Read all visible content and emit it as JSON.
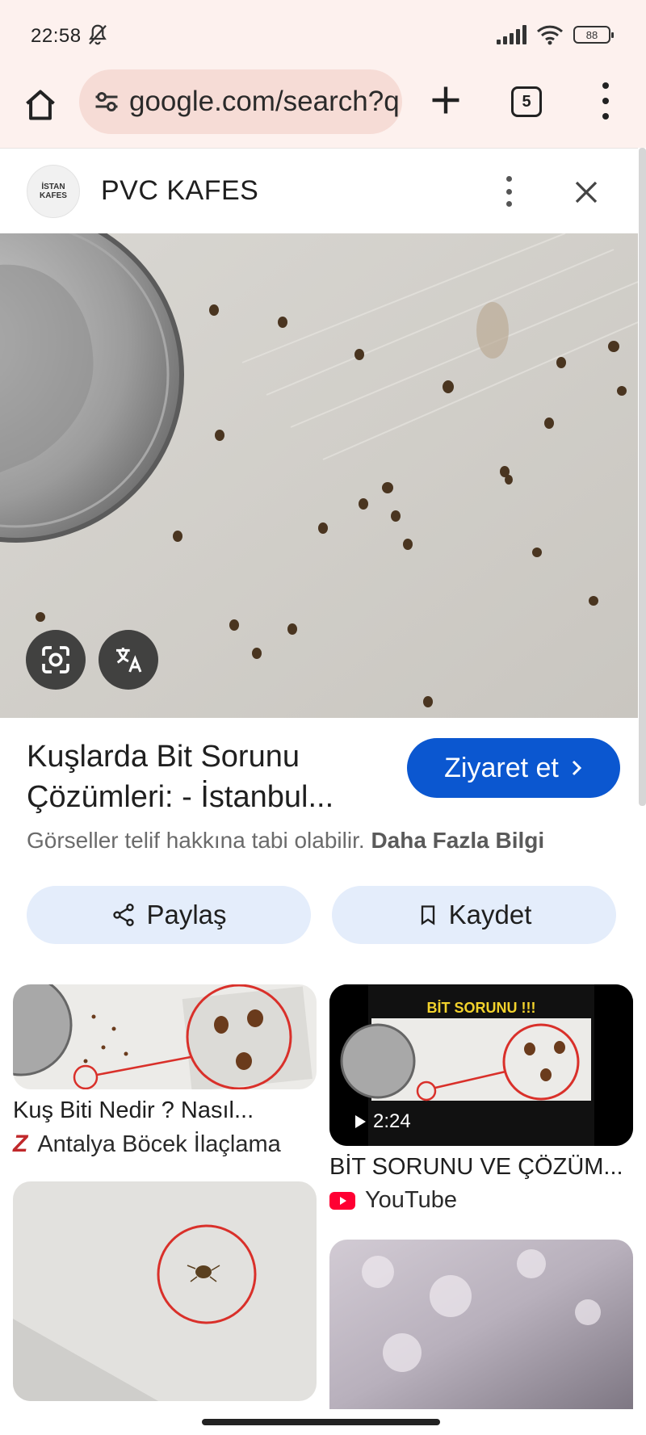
{
  "status_bar": {
    "time": "22:58",
    "battery": "88"
  },
  "browser": {
    "url": "google.com/search?q",
    "tab_count": "5"
  },
  "panel": {
    "site_logo_lines": [
      "İSTAN",
      "KAFES"
    ],
    "site_name": "PVC KAFES"
  },
  "result": {
    "title": "Kuşlarda Bit Sorunu Çözümleri: - İstanbul...",
    "visit_label": "Ziyaret et",
    "copyright_text": "Görseller telif hakkına tabi olabilir.",
    "copyright_link": "Daha Fazla Bilgi",
    "share_label": "Paylaş",
    "save_label": "Kaydet"
  },
  "related": [
    {
      "title": "Kuş Biti Nedir ? Nasıl...",
      "source": "Antalya Böcek İlaçlama",
      "source_icon": "Z"
    },
    {
      "title": "BİT SORUNU VE ÇÖZÜM...",
      "source": "YouTube",
      "duration": "2:24",
      "thumb_caption": "BİT SORUNU !!!"
    }
  ],
  "colors": {
    "accent": "#0b57d0",
    "toolbar_bg": "#fdf1ee",
    "url_pill": "#f6dcd6",
    "chip_bg": "#e4edfb"
  },
  "icons": [
    "home-icon",
    "tune-icon",
    "plus-icon",
    "tabs-icon",
    "menu-icon",
    "kebab-icon",
    "close-icon",
    "lens-icon",
    "translate-icon",
    "share-icon",
    "bookmark-icon",
    "play-icon",
    "youtube-icon",
    "bell-off-icon",
    "wifi-icon",
    "signal-icon"
  ]
}
